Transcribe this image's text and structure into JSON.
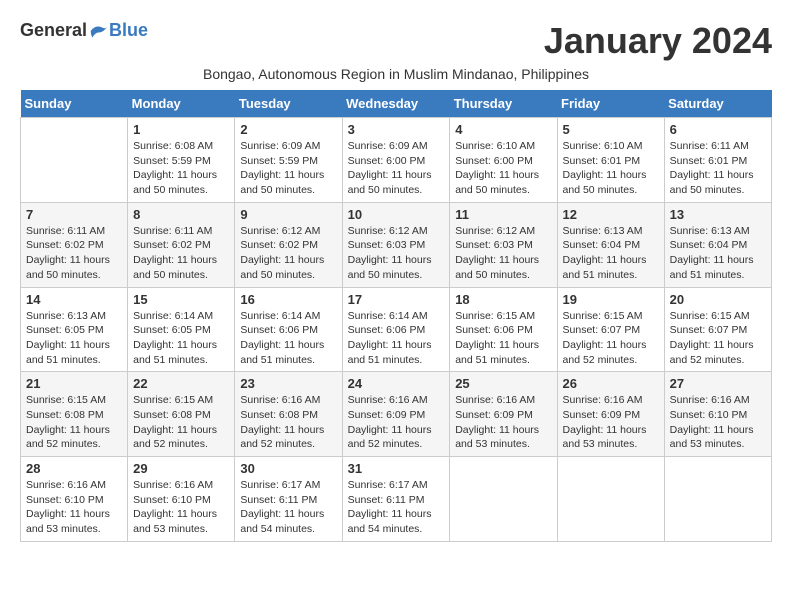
{
  "logo": {
    "general": "General",
    "blue": "Blue"
  },
  "title": "January 2024",
  "subtitle": "Bongao, Autonomous Region in Muslim Mindanao, Philippines",
  "headers": [
    "Sunday",
    "Monday",
    "Tuesday",
    "Wednesday",
    "Thursday",
    "Friday",
    "Saturday"
  ],
  "weeks": [
    [
      {
        "date": "",
        "info": ""
      },
      {
        "date": "1",
        "info": "Sunrise: 6:08 AM\nSunset: 5:59 PM\nDaylight: 11 hours and 50 minutes."
      },
      {
        "date": "2",
        "info": "Sunrise: 6:09 AM\nSunset: 5:59 PM\nDaylight: 11 hours and 50 minutes."
      },
      {
        "date": "3",
        "info": "Sunrise: 6:09 AM\nSunset: 6:00 PM\nDaylight: 11 hours and 50 minutes."
      },
      {
        "date": "4",
        "info": "Sunrise: 6:10 AM\nSunset: 6:00 PM\nDaylight: 11 hours and 50 minutes."
      },
      {
        "date": "5",
        "info": "Sunrise: 6:10 AM\nSunset: 6:01 PM\nDaylight: 11 hours and 50 minutes."
      },
      {
        "date": "6",
        "info": "Sunrise: 6:11 AM\nSunset: 6:01 PM\nDaylight: 11 hours and 50 minutes."
      }
    ],
    [
      {
        "date": "7",
        "info": "Sunrise: 6:11 AM\nSunset: 6:02 PM\nDaylight: 11 hours and 50 minutes."
      },
      {
        "date": "8",
        "info": "Sunrise: 6:11 AM\nSunset: 6:02 PM\nDaylight: 11 hours and 50 minutes."
      },
      {
        "date": "9",
        "info": "Sunrise: 6:12 AM\nSunset: 6:02 PM\nDaylight: 11 hours and 50 minutes."
      },
      {
        "date": "10",
        "info": "Sunrise: 6:12 AM\nSunset: 6:03 PM\nDaylight: 11 hours and 50 minutes."
      },
      {
        "date": "11",
        "info": "Sunrise: 6:12 AM\nSunset: 6:03 PM\nDaylight: 11 hours and 50 minutes."
      },
      {
        "date": "12",
        "info": "Sunrise: 6:13 AM\nSunset: 6:04 PM\nDaylight: 11 hours and 51 minutes."
      },
      {
        "date": "13",
        "info": "Sunrise: 6:13 AM\nSunset: 6:04 PM\nDaylight: 11 hours and 51 minutes."
      }
    ],
    [
      {
        "date": "14",
        "info": "Sunrise: 6:13 AM\nSunset: 6:05 PM\nDaylight: 11 hours and 51 minutes."
      },
      {
        "date": "15",
        "info": "Sunrise: 6:14 AM\nSunset: 6:05 PM\nDaylight: 11 hours and 51 minutes."
      },
      {
        "date": "16",
        "info": "Sunrise: 6:14 AM\nSunset: 6:06 PM\nDaylight: 11 hours and 51 minutes."
      },
      {
        "date": "17",
        "info": "Sunrise: 6:14 AM\nSunset: 6:06 PM\nDaylight: 11 hours and 51 minutes."
      },
      {
        "date": "18",
        "info": "Sunrise: 6:15 AM\nSunset: 6:06 PM\nDaylight: 11 hours and 51 minutes."
      },
      {
        "date": "19",
        "info": "Sunrise: 6:15 AM\nSunset: 6:07 PM\nDaylight: 11 hours and 52 minutes."
      },
      {
        "date": "20",
        "info": "Sunrise: 6:15 AM\nSunset: 6:07 PM\nDaylight: 11 hours and 52 minutes."
      }
    ],
    [
      {
        "date": "21",
        "info": "Sunrise: 6:15 AM\nSunset: 6:08 PM\nDaylight: 11 hours and 52 minutes."
      },
      {
        "date": "22",
        "info": "Sunrise: 6:15 AM\nSunset: 6:08 PM\nDaylight: 11 hours and 52 minutes."
      },
      {
        "date": "23",
        "info": "Sunrise: 6:16 AM\nSunset: 6:08 PM\nDaylight: 11 hours and 52 minutes."
      },
      {
        "date": "24",
        "info": "Sunrise: 6:16 AM\nSunset: 6:09 PM\nDaylight: 11 hours and 52 minutes."
      },
      {
        "date": "25",
        "info": "Sunrise: 6:16 AM\nSunset: 6:09 PM\nDaylight: 11 hours and 53 minutes."
      },
      {
        "date": "26",
        "info": "Sunrise: 6:16 AM\nSunset: 6:09 PM\nDaylight: 11 hours and 53 minutes."
      },
      {
        "date": "27",
        "info": "Sunrise: 6:16 AM\nSunset: 6:10 PM\nDaylight: 11 hours and 53 minutes."
      }
    ],
    [
      {
        "date": "28",
        "info": "Sunrise: 6:16 AM\nSunset: 6:10 PM\nDaylight: 11 hours and 53 minutes."
      },
      {
        "date": "29",
        "info": "Sunrise: 6:16 AM\nSunset: 6:10 PM\nDaylight: 11 hours and 53 minutes."
      },
      {
        "date": "30",
        "info": "Sunrise: 6:17 AM\nSunset: 6:11 PM\nDaylight: 11 hours and 54 minutes."
      },
      {
        "date": "31",
        "info": "Sunrise: 6:17 AM\nSunset: 6:11 PM\nDaylight: 11 hours and 54 minutes."
      },
      {
        "date": "",
        "info": ""
      },
      {
        "date": "",
        "info": ""
      },
      {
        "date": "",
        "info": ""
      }
    ]
  ]
}
